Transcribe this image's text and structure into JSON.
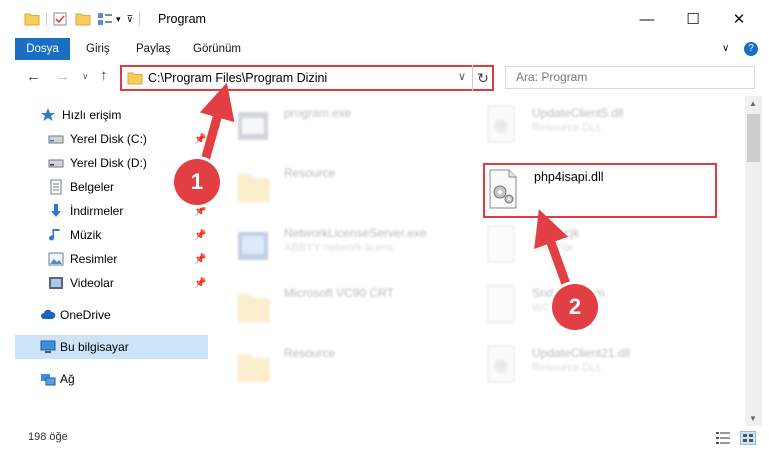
{
  "window": {
    "title": "Program",
    "minimize": "—",
    "maximize": "☐",
    "close": "✕"
  },
  "ribbon": {
    "tabs": [
      "Dosya",
      "Giriş",
      "Paylaş",
      "Görünüm"
    ],
    "help": "?",
    "expand": "∨"
  },
  "nav": {
    "back": "←",
    "forward": "→",
    "recent": "∨",
    "up": "↑",
    "address": "C:\\Program Files\\Program Dizini",
    "dropdown": "∨",
    "refresh": "↻",
    "search_placeholder": "Ara: Program"
  },
  "sidebar": {
    "items": [
      {
        "label": "Hızlı erişim",
        "icon": "star-icon"
      },
      {
        "label": "Yerel Disk (C:)",
        "icon": "disk-icon",
        "pinned": true
      },
      {
        "label": "Yerel Disk (D:)",
        "icon": "disk-icon",
        "pinned": true
      },
      {
        "label": "Belgeler",
        "icon": "document-icon",
        "pinned": true
      },
      {
        "label": "İndirmeler",
        "icon": "download-icon",
        "pinned": true
      },
      {
        "label": "Müzik",
        "icon": "music-icon",
        "pinned": true
      },
      {
        "label": "Resimler",
        "icon": "pictures-icon",
        "pinned": true
      },
      {
        "label": "Videolar",
        "icon": "video-icon",
        "pinned": true
      },
      {
        "label": "OneDrive",
        "icon": "cloud-icon"
      },
      {
        "label": "Bu bilgisayar",
        "icon": "computer-icon",
        "selected": true
      },
      {
        "label": "Ağ",
        "icon": "network-icon"
      }
    ]
  },
  "files": {
    "left": [
      {
        "name": "program.exe",
        "sub": "",
        "type": "exe"
      },
      {
        "name": "Resource",
        "sub": "",
        "type": "folder"
      },
      {
        "name": "NetworkLicenseServer.exe",
        "sub": "ABBYY network licens",
        "type": "exe2"
      },
      {
        "name": "Microsoft VC90 CRT",
        "sub": "",
        "type": "folder"
      },
      {
        "name": "Resource",
        "sub": "",
        "type": "folder"
      }
    ],
    "right": [
      {
        "name": "UpdateClient5.dll",
        "sub": "Resource DLL",
        "type": "dll",
        "dim": true
      },
      {
        "name": "php4isapi.dll",
        "sub": "",
        "type": "dll",
        "dim": false
      },
      {
        "name": "...nml.cjk",
        "sub": "CJK File",
        "type": "file",
        "dim": true
      },
      {
        "name": "Snd...06.wcm",
        "sub": "WCM File",
        "type": "file",
        "dim": true
      },
      {
        "name": "UpdateClient21.dll",
        "sub": "Resource DLL",
        "type": "dll",
        "dim": true
      }
    ]
  },
  "annotations": {
    "step1": "1",
    "step2": "2"
  },
  "status": {
    "count": "198 öğe"
  },
  "colors": {
    "accent": "#1a6fc4",
    "highlight": "#e03a3e",
    "selected_bg": "#cce4f7"
  }
}
